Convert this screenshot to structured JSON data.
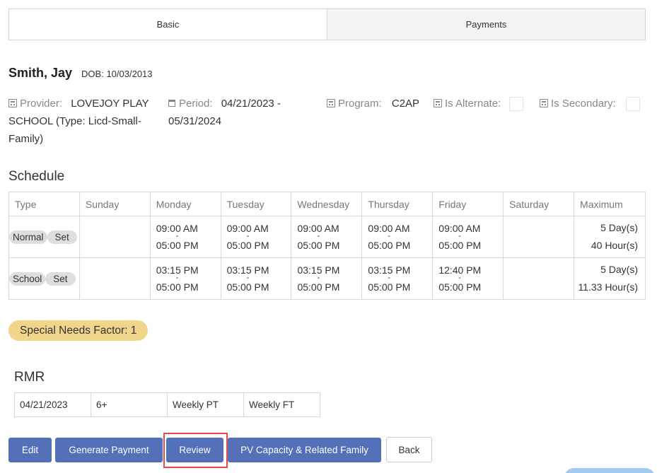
{
  "tabs": [
    {
      "label": "Basic",
      "active": true
    },
    {
      "label": "Payments",
      "active": false
    }
  ],
  "child": {
    "name": "Smith, Jay",
    "dob": "DOB: 10/03/2013"
  },
  "info": {
    "provider_label": "Provider:",
    "provider_value_line1": "LOVEJOY PLAY",
    "provider_value_line2": "SCHOOL (Type: Licd-Small-",
    "provider_value_line3": "Family)",
    "period_label": "Period:",
    "period_value_line1": "04/21/2023 -",
    "period_value_line2": "05/31/2024",
    "program_label": "Program:",
    "program_value": "C2AP",
    "alternate_label": "Is Alternate:",
    "alternate_checked": false,
    "secondary_label": "Is Secondary:",
    "secondary_checked": false
  },
  "schedule": {
    "title": "Schedule",
    "headers": [
      "Type",
      "Sunday",
      "Monday",
      "Tuesday",
      "Wednesday",
      "Thursday",
      "Friday",
      "Saturday",
      "Maximum"
    ],
    "rows": [
      {
        "type": "Normal",
        "set_label": "Set",
        "days": {
          "sunday": {
            "start": "",
            "end": ""
          },
          "monday": {
            "start": "09:00 AM",
            "end": "05:00 PM"
          },
          "tuesday": {
            "start": "09:00 AM",
            "end": "05:00 PM"
          },
          "wednesday": {
            "start": "09:00 AM",
            "end": "05:00 PM"
          },
          "thursday": {
            "start": "09:00 AM",
            "end": "05:00 PM"
          },
          "friday": {
            "start": "09:00 AM",
            "end": "05:00 PM"
          },
          "saturday": {
            "start": "",
            "end": ""
          }
        },
        "max_days": "5 Day(s)",
        "max_hours": "40 Hour(s)"
      },
      {
        "type": "School",
        "set_label": "Set",
        "days": {
          "sunday": {
            "start": "",
            "end": ""
          },
          "monday": {
            "start": "03:15 PM",
            "end": "05:00 PM"
          },
          "tuesday": {
            "start": "03:15 PM",
            "end": "05:00 PM"
          },
          "wednesday": {
            "start": "03:15 PM",
            "end": "05:00 PM"
          },
          "thursday": {
            "start": "03:15 PM",
            "end": "05:00 PM"
          },
          "friday": {
            "start": "12:40 PM",
            "end": "05:00 PM"
          },
          "saturday": {
            "start": "",
            "end": ""
          }
        },
        "max_days": "5 Day(s)",
        "max_hours": "11.33 Hour(s)"
      }
    ],
    "separator": "-"
  },
  "special_needs": "Special Needs Factor: 1",
  "rmr": {
    "title": "RMR",
    "cells": [
      "04/21/2023",
      "6+",
      "Weekly PT",
      "Weekly FT"
    ]
  },
  "buttons": {
    "edit": "Edit",
    "generate_payment": "Generate Payment",
    "review": "Review",
    "pv_capacity": "PV Capacity & Related Family",
    "back": "Back"
  },
  "colors": {
    "primary_button": "#5470b8",
    "special_badge": "#f0d58a",
    "highlight_border": "#e24b4b",
    "pill": "#dedede"
  },
  "icons": {
    "provider": "calculator-icon",
    "period": "calendar-icon",
    "program": "calculator-icon",
    "alternate": "calculator-icon",
    "secondary": "calculator-icon"
  }
}
